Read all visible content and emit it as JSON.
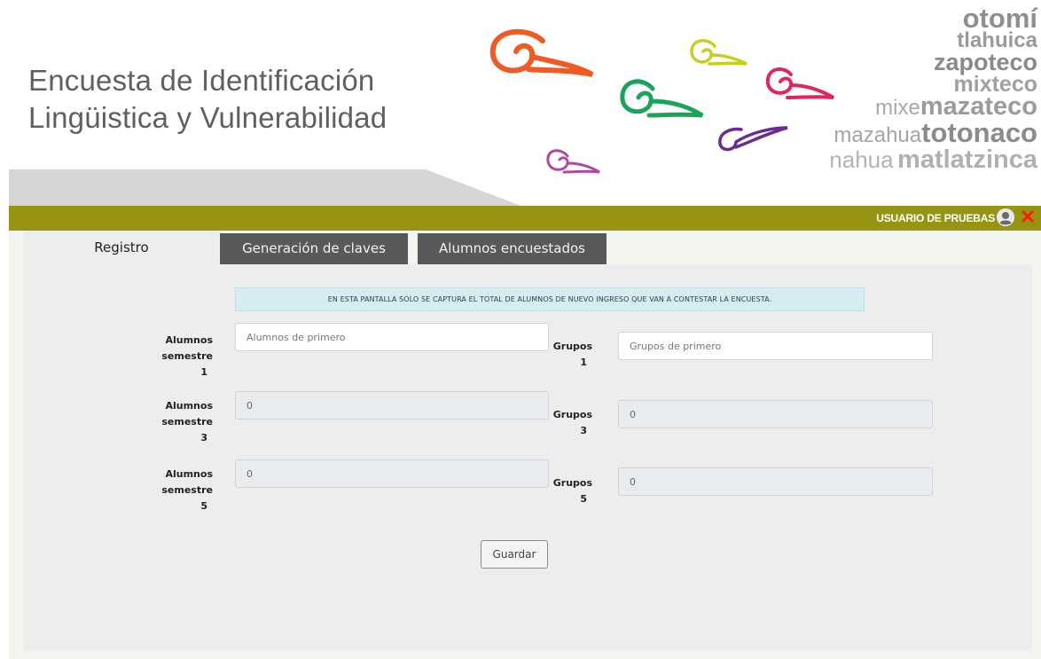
{
  "header": {
    "title_line1": "Encuesta de Identificación",
    "title_line2": "Lingüistica y Vulnerabilidad",
    "languages": {
      "otomi": "otomí",
      "tlahuica": "tlahuica",
      "zapoteco": "zapoteco",
      "mixteco": "mixteco",
      "mixe": "mixe",
      "mazateco": "mazateco",
      "mazahua": "mazahua",
      "totonaco": "totonaco",
      "nahua": "nahua",
      "matlatzinca": "matlatzinca"
    },
    "swirl_colors": [
      "#f05a24",
      "#c6cf1f",
      "#e0245e",
      "#1aa35a",
      "#6b2c91",
      "#b04aa0"
    ]
  },
  "userbar": {
    "user_label": "USUARIO DE PRUEBAS",
    "bar_color": "#989413",
    "close_color": "#ff1a00"
  },
  "tabs": [
    {
      "label": "Registro",
      "active": true
    },
    {
      "label": "Generación de claves",
      "active": false
    },
    {
      "label": "Alumnos encuestados",
      "active": false
    }
  ],
  "notice": "EN ESTA PANTALLA SOLO SE CAPTURA EL TOTAL DE ALUMNOS DE NUEVO INGRESO QUE VAN A CONTESTAR LA ENCUESTA.",
  "form": {
    "rows": [
      {
        "alumnos_label_1": "Alumnos",
        "alumnos_label_2": "semestre",
        "alumnos_num": "1",
        "alumnos_placeholder": "Alumnos de primero",
        "alumnos_value": "",
        "grupos_label": "Grupos",
        "grupos_num": "1",
        "grupos_placeholder": "Grupos de primero",
        "grupos_value": ""
      },
      {
        "alumnos_label_1": "Alumnos",
        "alumnos_label_2": "semestre",
        "alumnos_num": "3",
        "alumnos_value": "0",
        "grupos_label": "Grupos",
        "grupos_num": "3",
        "grupos_value": "0"
      },
      {
        "alumnos_label_1": "Alumnos",
        "alumnos_label_2": "semestre",
        "alumnos_num": "5",
        "alumnos_value": "0",
        "grupos_label": "Grupos",
        "grupos_num": "5",
        "grupos_value": "0"
      }
    ],
    "save_label": "Guardar"
  }
}
